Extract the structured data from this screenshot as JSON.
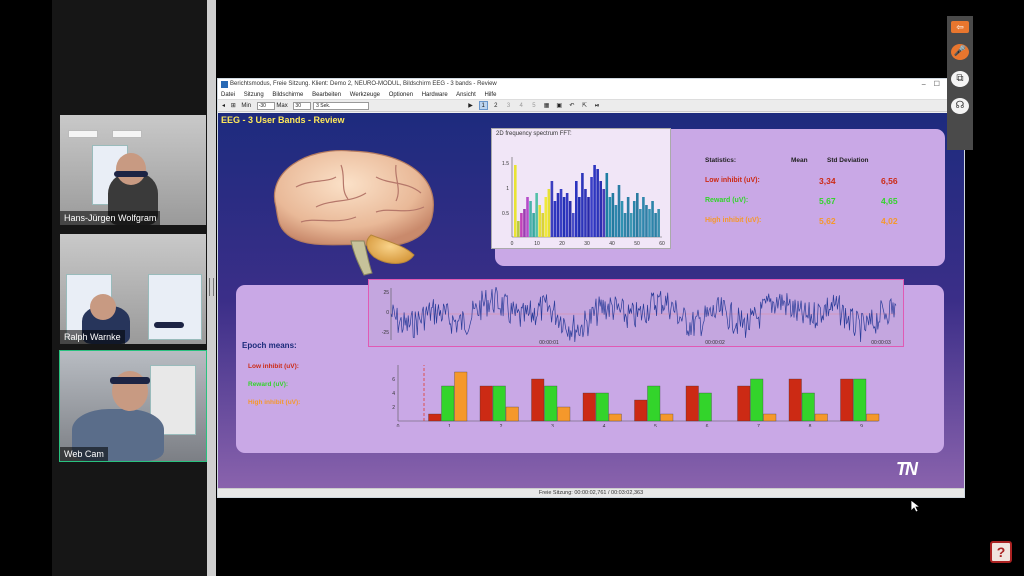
{
  "participants": [
    {
      "name": "Hans-Jürgen Wolfgram",
      "active": false
    },
    {
      "name": "Ralph Warnke",
      "active": false
    },
    {
      "name": "Web Cam",
      "active": true
    }
  ],
  "window": {
    "title": "Berichtsmodus, Freie Sitzung. Klient: Demo 2, NEURO-MODUL, Bildschirm EEG - 3 bands - Review",
    "menu": [
      "Datei",
      "Sitzung",
      "Bildschirme",
      "Bearbeiten",
      "Werkzeuge",
      "Optionen",
      "Hardware",
      "Ansicht",
      "Hilfe"
    ],
    "toolbar": {
      "min_label": "Min",
      "min_value": "-30",
      "max_label": "Max",
      "max_value": "30",
      "timescale": "3 Sek.",
      "pages": [
        "1",
        "2",
        "3",
        "4",
        "5"
      ],
      "active_page": "1"
    }
  },
  "screen": {
    "title": "EEG - 3 User Bands - Review",
    "fft_title": "2D frequency spectrum FFT:",
    "fft_ticks_x": [
      "0",
      "10",
      "20",
      "30",
      "40",
      "50",
      "60"
    ],
    "fft_ticks_y": [
      "1.5",
      "1",
      "0.5"
    ],
    "stats": {
      "header_label": "Statistics:",
      "header_mean": "Mean",
      "header_std": "Std Deviation",
      "rows": [
        {
          "label": "Low inhibit (uV):",
          "mean": "3,34",
          "std": "6,56",
          "color": "#cc2a14"
        },
        {
          "label": "Reward (uV):",
          "mean": "5,67",
          "std": "4,65",
          "color": "#33d42b"
        },
        {
          "label": "High inhibit (uV):",
          "mean": "5,62",
          "std": "4,02",
          "color": "#f5982b"
        }
      ]
    },
    "eeg_ticks_y": [
      "25",
      "0",
      "-25"
    ],
    "eeg_times": [
      "00:00:01",
      "00:00:02",
      "00:00:03"
    ],
    "epoch_title": "Epoch means:",
    "epoch_labels": [
      "Low inhibit (uV):",
      "Reward (uV):",
      "High inhibit (uV):"
    ],
    "brand": "TN",
    "status": "Freie Sitzung: 00:00:02,761 / 00:03:02,363"
  },
  "chart_data": {
    "type": "bar",
    "categories": [
      "1",
      "2",
      "3",
      "4",
      "5",
      "6",
      "7",
      "8",
      "9"
    ],
    "series": [
      {
        "name": "Low inhibit (uV):",
        "color": "#cc2a14",
        "values": [
          1,
          5,
          6,
          4,
          3,
          5,
          5,
          6,
          6
        ]
      },
      {
        "name": "Reward (uV):",
        "color": "#33d42b",
        "values": [
          5,
          5,
          5,
          4,
          5,
          4,
          6,
          4,
          6
        ]
      },
      {
        "name": "High inhibit (uV):",
        "color": "#f5982b",
        "values": [
          7,
          2,
          2,
          1,
          1,
          0,
          1,
          1,
          1
        ]
      }
    ],
    "x_ticks": [
      "0",
      "1",
      "2",
      "3",
      "4",
      "5",
      "6",
      "7",
      "8",
      "9"
    ],
    "y_ticks": [
      "6",
      "4",
      "2"
    ],
    "ylim": [
      0,
      8
    ]
  }
}
